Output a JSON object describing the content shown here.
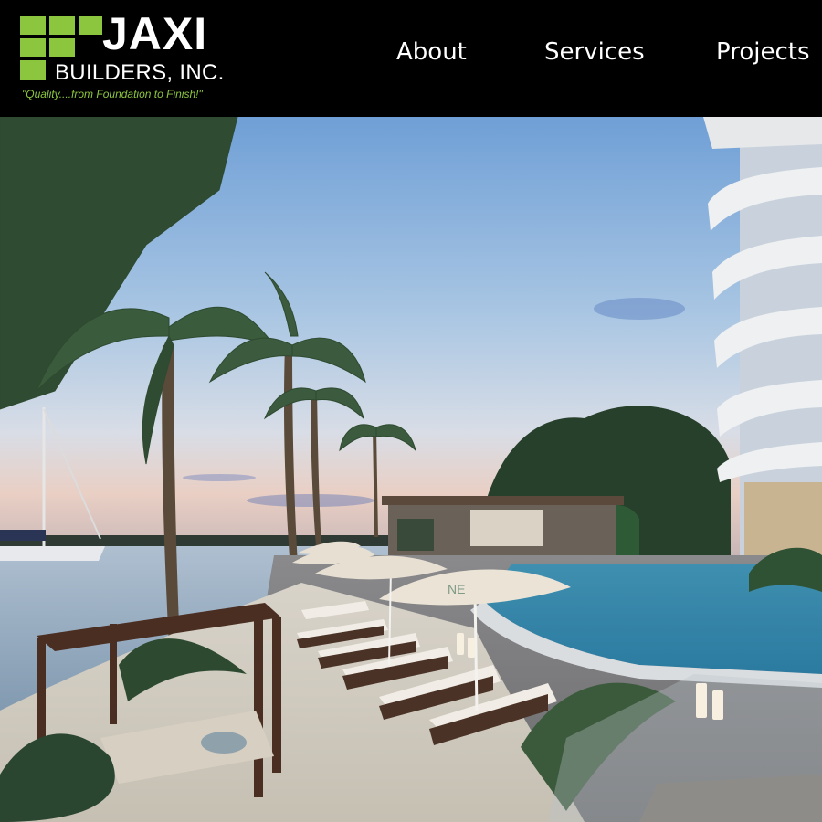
{
  "brand": {
    "name": "JAXI",
    "subtitle": "BUILDERS, INC.",
    "tagline": "\"Quality....from Foundation to Finish!\"",
    "accent_color": "#8cc63f"
  },
  "nav": {
    "items": [
      {
        "label": "About"
      },
      {
        "label": "Services"
      },
      {
        "label": "Projects"
      }
    ]
  },
  "hero": {
    "umbrella_text": "NE"
  }
}
